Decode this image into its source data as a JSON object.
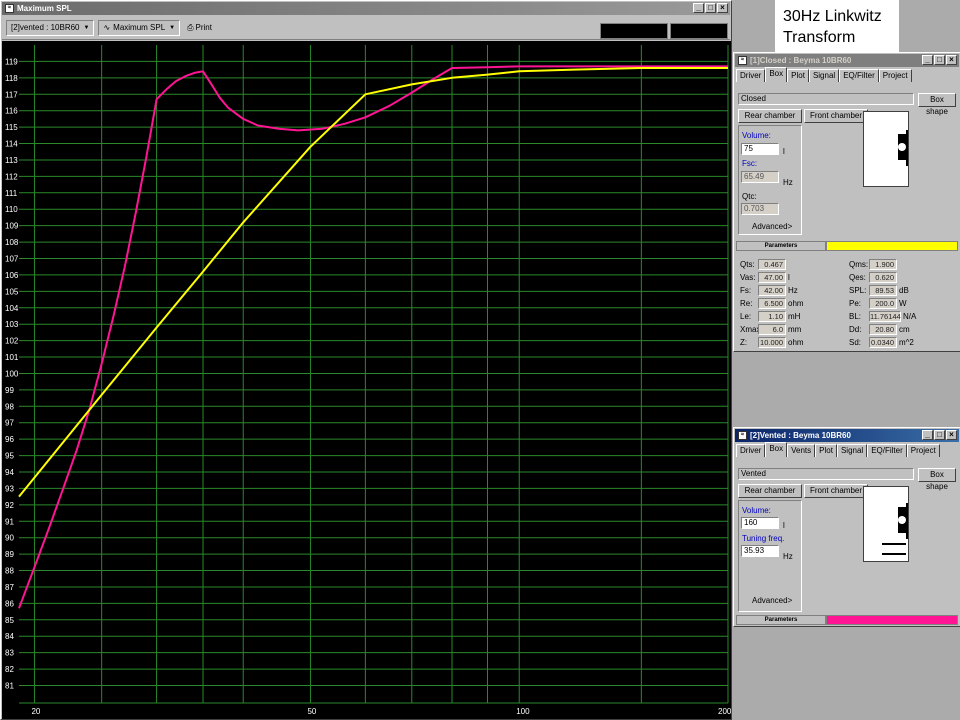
{
  "annotation": {
    "line1": "30Hz Linkwitz",
    "line2": "Transform"
  },
  "spl_window": {
    "title": "Maximum SPL",
    "toolbar": {
      "driver_select": "[2]vented : 10BR60",
      "mode_select": "Maximum SPL",
      "print_label": "Print"
    }
  },
  "chart_data": {
    "type": "line",
    "xscale": "log",
    "xlim": [
      19,
      200
    ],
    "ylim": [
      80.3,
      120
    ],
    "y_ticks": [
      81,
      82,
      83,
      84,
      85,
      86,
      87,
      88,
      89,
      90,
      91,
      92,
      93,
      94,
      95,
      96,
      97,
      98,
      99,
      100,
      101,
      102,
      103,
      104,
      105,
      106,
      107,
      108,
      109,
      110,
      111,
      112,
      113,
      114,
      115,
      116,
      117,
      118,
      119
    ],
    "x_ticks": [
      20,
      50,
      100,
      200
    ],
    "x_gridlines": [
      20,
      25,
      30,
      35,
      40,
      50,
      60,
      70,
      80,
      90,
      100,
      150,
      200
    ],
    "grid": true,
    "series": [
      {
        "color": "#ff1493",
        "points": [
          [
            19,
            85.7
          ],
          [
            20,
            88.2
          ],
          [
            21,
            90.6
          ],
          [
            22,
            93.0
          ],
          [
            23,
            95.3
          ],
          [
            24,
            97.8
          ],
          [
            25,
            100.6
          ],
          [
            26,
            103.5
          ],
          [
            27,
            106.5
          ],
          [
            28,
            109.8
          ],
          [
            29,
            113.2
          ],
          [
            30,
            116.7
          ],
          [
            31,
            117.3
          ],
          [
            32,
            117.8
          ],
          [
            33,
            118.1
          ],
          [
            34,
            118.3
          ],
          [
            35,
            118.4
          ],
          [
            36,
            117.6
          ],
          [
            37,
            116.8
          ],
          [
            38,
            116.2
          ],
          [
            40,
            115.5
          ],
          [
            42,
            115.1
          ],
          [
            45,
            114.9
          ],
          [
            48,
            114.8
          ],
          [
            52,
            114.9
          ],
          [
            56,
            115.2
          ],
          [
            60,
            115.6
          ],
          [
            65,
            116.3
          ],
          [
            70,
            117.1
          ],
          [
            75,
            117.9
          ],
          [
            80,
            118.6
          ],
          [
            90,
            118.65
          ],
          [
            100,
            118.7
          ],
          [
            120,
            118.7
          ],
          [
            150,
            118.7
          ],
          [
            200,
            118.7
          ]
        ]
      },
      {
        "color": "#ffff00",
        "points": [
          [
            19,
            92.5
          ],
          [
            25,
            98.7
          ],
          [
            30,
            102.8
          ],
          [
            35,
            106.2
          ],
          [
            40,
            109.2
          ],
          [
            50,
            113.8
          ],
          [
            60,
            117.0
          ],
          [
            70,
            117.6
          ],
          [
            80,
            118.0
          ],
          [
            90,
            118.2
          ],
          [
            100,
            118.4
          ],
          [
            120,
            118.5
          ],
          [
            150,
            118.6
          ],
          [
            200,
            118.6
          ]
        ]
      }
    ]
  },
  "closed_panel": {
    "title": "[1]Closed : Beyma 10BR60",
    "tabs": [
      "Driver",
      "Box",
      "Plot",
      "Signal",
      "EQ/Filter",
      "Project"
    ],
    "box_type": "Closed",
    "box_shape_btn": "Box shape",
    "rear_chamber_btn": "Rear chamber",
    "front_chamber_btn": "Front chamber",
    "volume_label": "Volume:",
    "volume_value": "75",
    "volume_unit": "l",
    "fsc_label": "Fsc:",
    "fsc_value": "65.49",
    "fsc_unit": "Hz",
    "qtc_label": "Qtc:",
    "qtc_value": "0.703",
    "advanced_btn": "Advanced>",
    "parameters_label": "Parameters",
    "parameters_color": "#ffff00",
    "params_left": [
      {
        "label": "Qts:",
        "value": "0.467",
        "unit": ""
      },
      {
        "label": "Vas:",
        "value": "47.00",
        "unit": "l"
      },
      {
        "label": "Fs:",
        "value": "42.00",
        "unit": "Hz"
      },
      {
        "label": "Re:",
        "value": "6.500",
        "unit": "ohm"
      },
      {
        "label": "Le:",
        "value": "1.10",
        "unit": "mH"
      },
      {
        "label": "Xmax:",
        "value": "6.0",
        "unit": "mm"
      },
      {
        "label": "Z:",
        "value": "10.000",
        "unit": "ohm"
      }
    ],
    "params_right": [
      {
        "label": "Qms:",
        "value": "1.900",
        "unit": ""
      },
      {
        "label": "Qes:",
        "value": "0.620",
        "unit": ""
      },
      {
        "label": "SPL:",
        "value": "89.53",
        "unit": "dB"
      },
      {
        "label": "Pe:",
        "value": "200.0",
        "unit": "W"
      },
      {
        "label": "BL:",
        "value": "11.76144",
        "unit": "N/A"
      },
      {
        "label": "Dd:",
        "value": "20.80",
        "unit": "cm"
      },
      {
        "label": "Sd:",
        "value": "0.0340",
        "unit": "m^2"
      }
    ]
  },
  "vented_panel": {
    "title": "[2]Vented : Beyma 10BR60",
    "tabs": [
      "Driver",
      "Box",
      "Vents",
      "Plot",
      "Signal",
      "EQ/Filter",
      "Project"
    ],
    "box_type": "Vented",
    "box_shape_btn": "Box shape",
    "rear_chamber_btn": "Rear chamber",
    "front_chamber_btn": "Front chamber",
    "volume_label": "Volume:",
    "volume_value": "160",
    "volume_unit": "l",
    "tuning_label": "Tuning freq.",
    "tuning_value": "35.93",
    "tuning_unit": "Hz",
    "advanced_btn": "Advanced>",
    "parameters_label": "Parameters",
    "parameters_color": "#ff1493"
  }
}
